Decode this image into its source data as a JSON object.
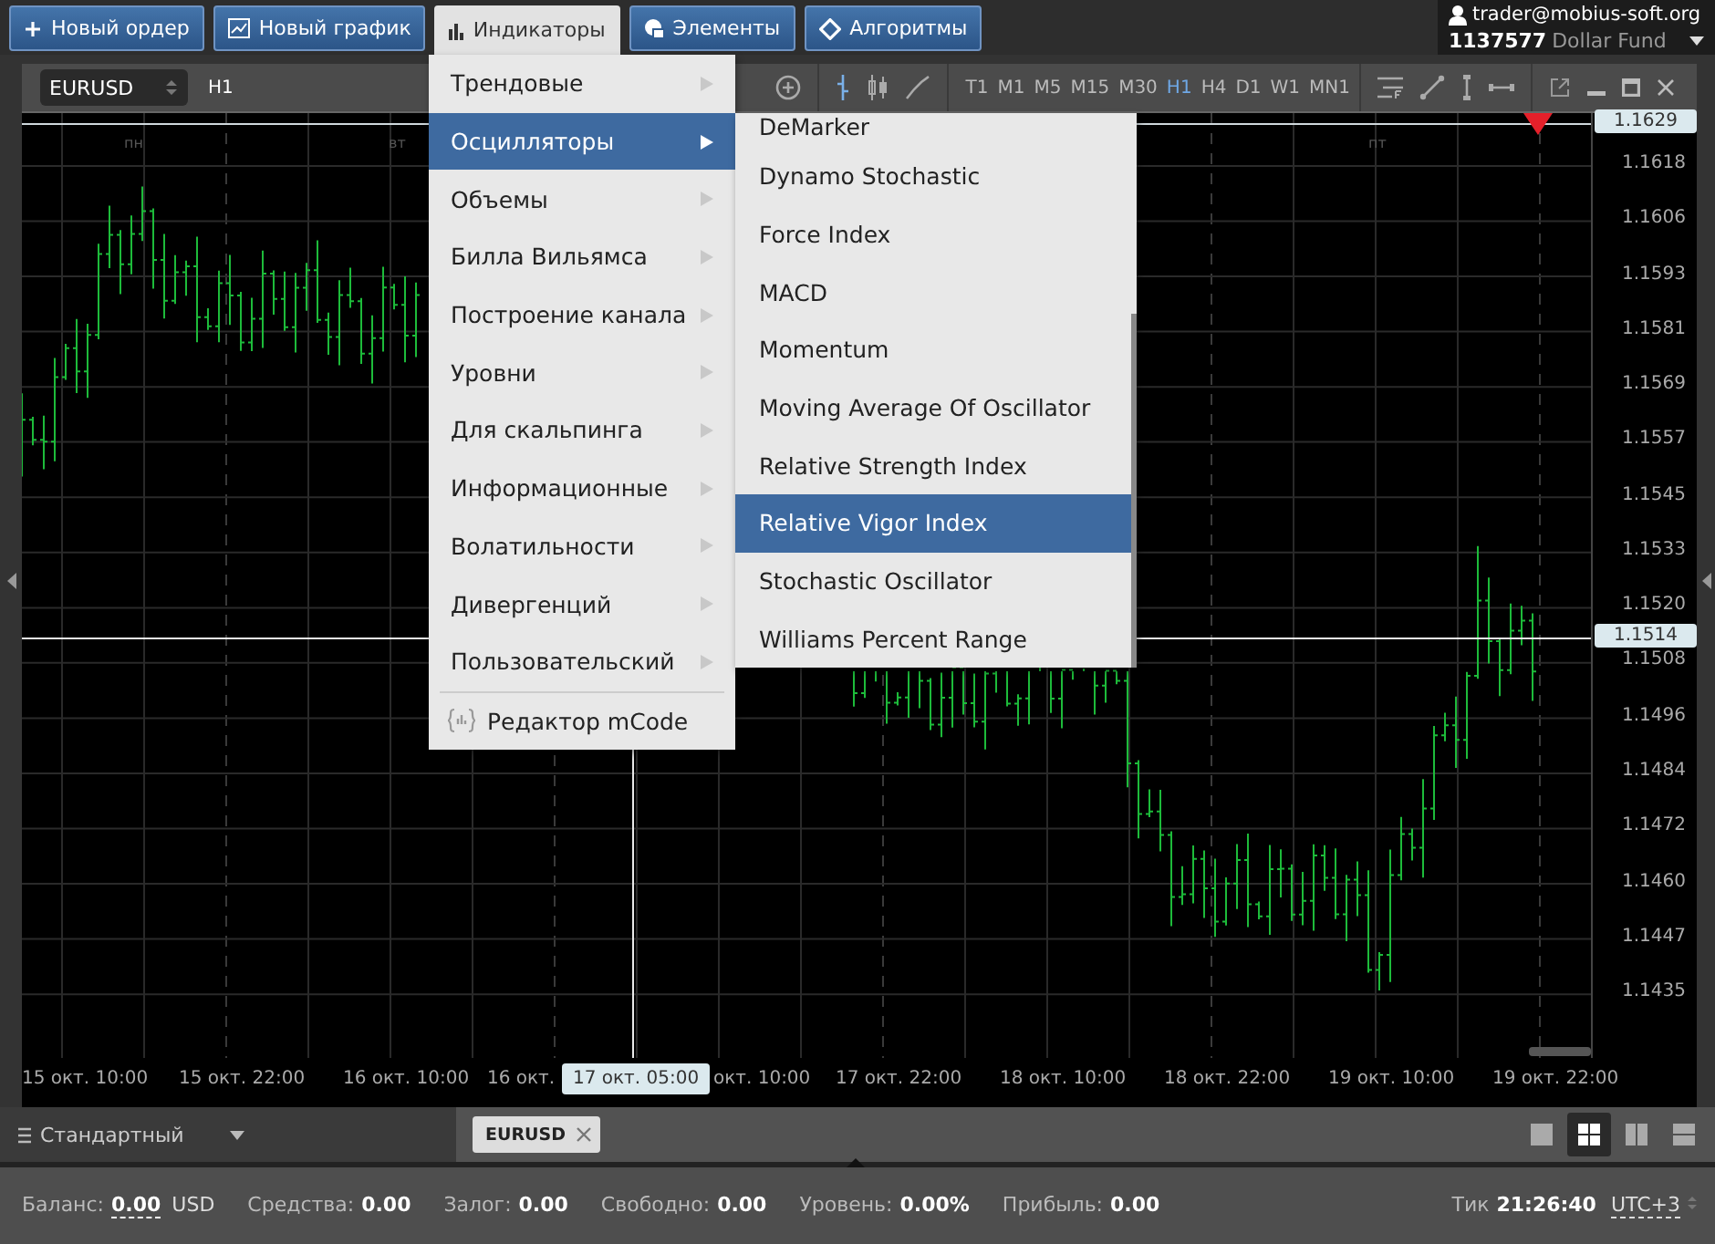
{
  "toolbar": {
    "buttons": [
      {
        "label": "Новый ордер",
        "selected": false
      },
      {
        "label": "Новый график",
        "selected": false
      },
      {
        "label": "Индикаторы",
        "selected": true
      },
      {
        "label": "Элементы",
        "selected": false
      },
      {
        "label": "Алгоритмы",
        "selected": false
      }
    ]
  },
  "account": {
    "user": "trader@mobius-soft.org",
    "number": "1137577",
    "fund": "Dollar Fund"
  },
  "chart_window": {
    "symbol": "EURUSD",
    "timeframe": "H1",
    "timeframes": [
      {
        "label": "T1",
        "selected": false
      },
      {
        "label": "M1",
        "selected": false
      },
      {
        "label": "M5",
        "selected": false
      },
      {
        "label": "M15",
        "selected": false
      },
      {
        "label": "M30",
        "selected": false
      },
      {
        "label": "H1",
        "selected": true
      },
      {
        "label": "H4",
        "selected": false
      },
      {
        "label": "D1",
        "selected": false
      },
      {
        "label": "W1",
        "selected": false
      },
      {
        "label": "MN1",
        "selected": false
      }
    ],
    "day_labels": [
      "пн",
      "вт",
      "пт"
    ],
    "price_labels": [
      "1.1618",
      "1.1606",
      "1.1593",
      "1.1581",
      "1.1569",
      "1.1557",
      "1.1545",
      "1.1533",
      "1.1520",
      "1.1508",
      "1.1496",
      "1.1484",
      "1.1472",
      "1.1460",
      "1.1447",
      "1.1435"
    ],
    "price_tags": [
      "1.1629",
      "1.1514"
    ],
    "time_labels": [
      "15 окт. 10:00",
      "15 окт. 22:00",
      "16 окт. 10:00",
      "16 окт.",
      "окт. 10:00",
      "17 окт. 22:00",
      "18 окт. 10:00",
      "18 окт. 22:00",
      "19 окт. 10:00",
      "19 окт. 22:00"
    ],
    "crosshair_time": "17 окт. 05:00"
  },
  "menu": {
    "items": [
      {
        "label": "Трендовые",
        "selected": false,
        "kind": "submenu"
      },
      {
        "label": "Осцилляторы",
        "selected": true,
        "kind": "submenu"
      },
      {
        "label": "Объемы",
        "selected": false,
        "kind": "submenu"
      },
      {
        "label": "Билла Вильямса",
        "selected": false,
        "kind": "submenu"
      },
      {
        "label": "Построение канала",
        "selected": false,
        "kind": "submenu"
      },
      {
        "label": "Уровни",
        "selected": false,
        "kind": "submenu"
      },
      {
        "label": "Для скальпинга",
        "selected": false,
        "kind": "submenu"
      },
      {
        "label": "Информационные",
        "selected": false,
        "kind": "submenu"
      },
      {
        "label": "Волатильности",
        "selected": false,
        "kind": "submenu"
      },
      {
        "label": "Дивергенций",
        "selected": false,
        "kind": "submenu"
      },
      {
        "label": "Пользовательский",
        "selected": false,
        "kind": "submenu"
      },
      {
        "label": "Редактор mCode",
        "selected": false,
        "kind": "editor"
      }
    ]
  },
  "submenu": {
    "items": [
      {
        "label": "DeMarker",
        "selected": false
      },
      {
        "label": "Dynamo Stochastic",
        "selected": false
      },
      {
        "label": "Force Index",
        "selected": false
      },
      {
        "label": "MACD",
        "selected": false
      },
      {
        "label": "Momentum",
        "selected": false
      },
      {
        "label": "Moving Average Of Oscillator",
        "selected": false
      },
      {
        "label": "Relative Strength Index",
        "selected": false
      },
      {
        "label": "Relative Vigor Index",
        "selected": true
      },
      {
        "label": "Stochastic Oscillator",
        "selected": false
      },
      {
        "label": "Williams Percent Range",
        "selected": false
      }
    ]
  },
  "workspace": {
    "name": "Стандартный",
    "tabs": [
      {
        "label": "EURUSD",
        "selected": true
      }
    ],
    "layouts": [
      {
        "selected": false
      },
      {
        "selected": true
      },
      {
        "selected": false
      },
      {
        "selected": false
      }
    ]
  },
  "status_bar": {
    "items": [
      {
        "label": "Баланс:",
        "value": "0.00",
        "unit": "USD",
        "kind": "editable"
      },
      {
        "label": "Средства:",
        "value": "0.00",
        "kind": "plain"
      },
      {
        "label": "Залог:",
        "value": "0.00",
        "kind": "plain"
      },
      {
        "label": "Свободно:",
        "value": "0.00",
        "kind": "plain"
      },
      {
        "label": "Уровень:",
        "value": "0.00%",
        "kind": "plain"
      },
      {
        "label": "Прибыль:",
        "value": "0.00",
        "kind": "plain"
      }
    ],
    "tick_label": "Тик",
    "tick_time": "21:26:40",
    "timezone": "UTC+3"
  }
}
